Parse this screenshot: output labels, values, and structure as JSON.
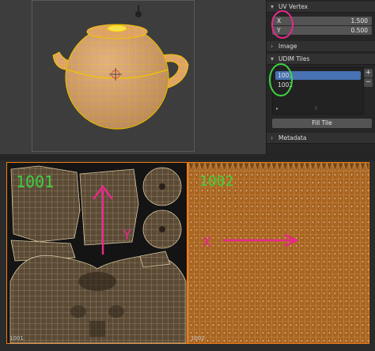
{
  "npanel": {
    "uv_vertex": {
      "title": "UV Vertex",
      "x_label": "X",
      "x_value": "1.500",
      "y_label": "Y",
      "y_value": "0.500"
    },
    "image": {
      "title": "Image"
    },
    "udim_tiles": {
      "title": "UDIM Tiles",
      "items": [
        "1001",
        "1002"
      ],
      "selected_index": 0,
      "add_label": "+",
      "remove_label": "−",
      "fill_tile_label": "Fill Tile"
    },
    "metadata": {
      "title": "Metadata"
    }
  },
  "uv_editor": {
    "tile_labels": [
      "1001",
      "1002"
    ],
    "handwritten": {
      "label_1001": "1001",
      "label_1002": "1002",
      "axis_y": "Y",
      "axis_x": "X"
    }
  },
  "colors": {
    "accent_orange": "#f07b12",
    "selection_blue": "#4772b3",
    "annotation_magenta": "#e8288a",
    "annotation_green": "#3fd13f"
  }
}
